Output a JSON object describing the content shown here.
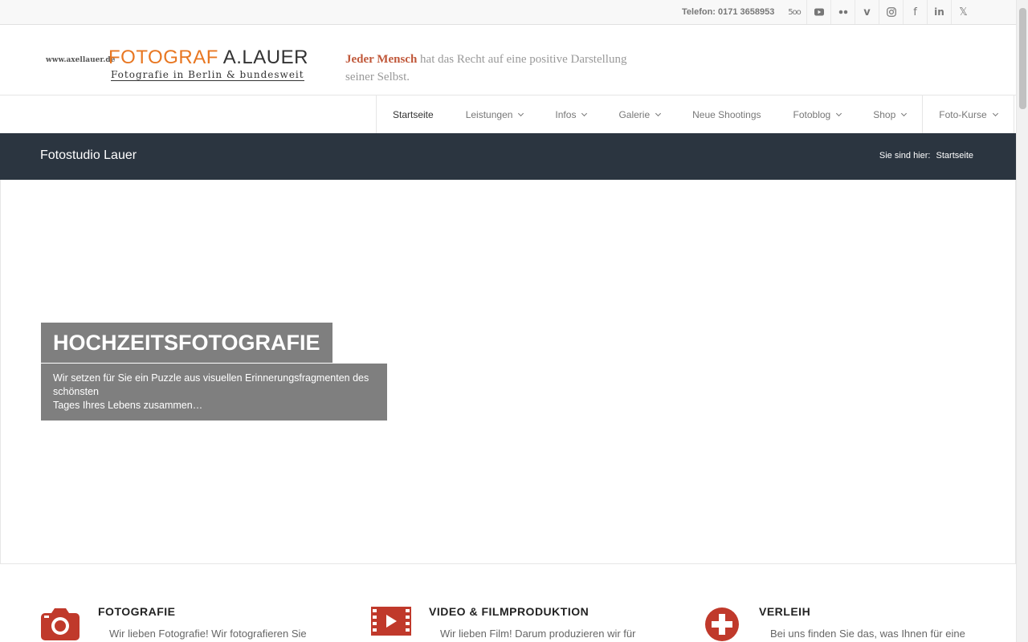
{
  "topbar": {
    "phone": "Telefon: 0171 3658953",
    "socials": [
      {
        "icon": "500px-icon",
        "glyph": "5oo"
      },
      {
        "icon": "youtube-icon",
        "glyph": ""
      },
      {
        "icon": "flickr-icon",
        "glyph": ""
      },
      {
        "icon": "vimeo-icon",
        "glyph": "v"
      },
      {
        "icon": "instagram-icon",
        "glyph": ""
      },
      {
        "icon": "facebook-icon",
        "glyph": "f"
      },
      {
        "icon": "linkedin-icon",
        "glyph": "in"
      },
      {
        "icon": "x-icon",
        "glyph": "𝕏"
      }
    ]
  },
  "header": {
    "logo_small": "www.axellauer.de",
    "logo_main_orange": "FOTOGRAF ",
    "logo_main_dark": "A.LAUER",
    "logo_sub": "Fotografie in Berlin & bundesweit",
    "tagline_highlight": "Jeder Mensch",
    "tagline_rest": " hat das Recht auf eine positive Darstellung seiner Selbst."
  },
  "nav": {
    "items": [
      {
        "label": "Startseite",
        "dropdown": false
      },
      {
        "label": "Leistungen",
        "dropdown": true
      },
      {
        "label": "Infos",
        "dropdown": true
      },
      {
        "label": "Galerie",
        "dropdown": true
      },
      {
        "label": "Neue Shootings",
        "dropdown": false
      },
      {
        "label": "Fotoblog",
        "dropdown": true
      },
      {
        "label": "Shop",
        "dropdown": true
      },
      {
        "label": "Foto-Kurse",
        "dropdown": true
      }
    ]
  },
  "titlebar": {
    "title": "Fotostudio Lauer",
    "breadcrumb_prefix": "Sie sind hier:",
    "breadcrumb_current": "Startseite"
  },
  "slider": {
    "heading": "HOCHZEITSFOTOGRAFIE",
    "text_line1": "Wir setzen für Sie ein Puzzle aus visuellen Erinnerungsfragmenten des schönsten",
    "text_line2": "Tages Ihres Lebens zusammen…"
  },
  "features": [
    {
      "title": "FOTOGRAFIE",
      "text": "Wir lieben Fotografie! Wir fotografieren Sie",
      "icon": "camera-icon"
    },
    {
      "title": "VIDEO & FILMPRODUKTION",
      "text": "Wir lieben Film! Darum produzieren wir für",
      "icon": "film-icon"
    },
    {
      "title": "VERLEIH",
      "text": "Bei uns finden Sie das, was Ihnen für eine",
      "icon": "plus-circle-icon"
    }
  ],
  "colors": {
    "accent_red": "#c0392b",
    "logo_orange": "#e87722",
    "titlebar_bg": "#2b3540",
    "caption_bg": "#7f7f7f"
  }
}
